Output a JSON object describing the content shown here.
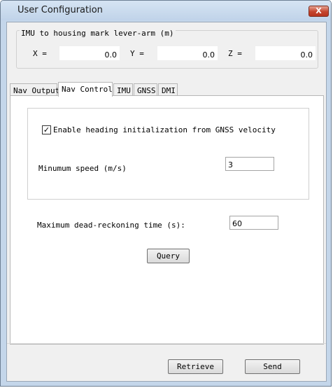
{
  "window": {
    "title": "User Configuration",
    "close_label": "X"
  },
  "lever_arm": {
    "group_label": "IMU to housing mark lever-arm (m)",
    "x_label": "X =",
    "x_value": "0.0",
    "y_label": "Y =",
    "y_value": "0.0",
    "z_label": "Z =",
    "z_value": "0.0"
  },
  "tabs": [
    "Nav Output",
    "Nav Control",
    "IMU",
    "GNSS",
    "DMI"
  ],
  "active_tab": "Nav Control",
  "nav_control": {
    "heading_init_checkbox": {
      "checked": true,
      "mark": "✓",
      "label": "Enable heading initialization from GNSS velocity"
    },
    "min_speed_label": "Minumum speed (m/s)",
    "min_speed_value": "3",
    "max_dr_label": "Maximum dead-reckoning time (s):",
    "max_dr_value": "60",
    "query_label": "Query"
  },
  "footer": {
    "retrieve_label": "Retrieve",
    "send_label": "Send"
  }
}
